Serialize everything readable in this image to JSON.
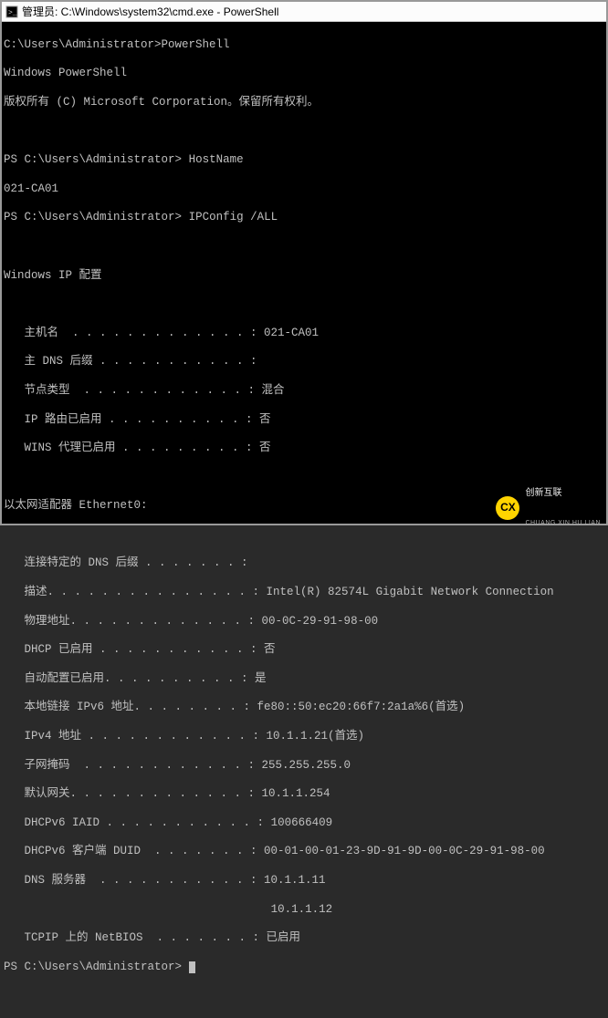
{
  "window": {
    "title": "管理员: C:\\Windows\\system32\\cmd.exe - PowerShell"
  },
  "session": {
    "prompt1_path": "C:\\Users\\Administrator>",
    "cmd1": "PowerShell",
    "banner1": "Windows PowerShell",
    "banner2": "版权所有 (C) Microsoft Corporation。保留所有权利。",
    "ps_prompt": "PS C:\\Users\\Administrator>",
    "cmd_hostname": "HostName",
    "hostname_out": "021-CA01",
    "cmd_ipconfig": "IPConfig /ALL"
  },
  "ipconfig": {
    "header": "Windows IP 配置",
    "global": {
      "hostname_label": "   主机名  . . . . . . . . . . . . . : ",
      "hostname_value": "021-CA01",
      "dns_suffix_label": "   主 DNS 后缀 . . . . . . . . . . . :",
      "node_type_label": "   节点类型  . . . . . . . . . . . . : ",
      "node_type_value": "混合",
      "ip_routing_label": "   IP 路由已启用 . . . . . . . . . . : ",
      "ip_routing_value": "否",
      "wins_proxy_label": "   WINS 代理已启用 . . . . . . . . . : ",
      "wins_proxy_value": "否"
    },
    "adapter_header": "以太网适配器 Ethernet0:",
    "adapter": {
      "conn_dns_label": "   连接特定的 DNS 后缀 . . . . . . . :",
      "desc_label": "   描述. . . . . . . . . . . . . . . : ",
      "desc_value": "Intel(R) 82574L Gigabit Network Connection",
      "phys_label": "   物理地址. . . . . . . . . . . . . : ",
      "phys_value": "00-0C-29-91-98-00",
      "dhcp_label": "   DHCP 已启用 . . . . . . . . . . . : ",
      "dhcp_value": "否",
      "autoconf_label": "   自动配置已启用. . . . . . . . . . : ",
      "autoconf_value": "是",
      "ll_ipv6_label": "   本地链接 IPv6 地址. . . . . . . . : ",
      "ll_ipv6_value": "fe80::50:ec20:66f7:2a1a%6(首选)",
      "ipv4_label": "   IPv4 地址 . . . . . . . . . . . . : ",
      "ipv4_value": "10.1.1.21(首选)",
      "mask_label": "   子网掩码  . . . . . . . . . . . . : ",
      "mask_value": "255.255.255.0",
      "gw_label": "   默认网关. . . . . . . . . . . . . : ",
      "gw_value": "10.1.1.254",
      "iaid_label": "   DHCPv6 IAID . . . . . . . . . . . : ",
      "iaid_value": "100666409",
      "duid_label": "   DHCPv6 客户端 DUID  . . . . . . . : ",
      "duid_value": "00-01-00-01-23-9D-91-9D-00-0C-29-91-98-00",
      "dns_label": "   DNS 服务器  . . . . . . . . . . . : ",
      "dns_value1": "10.1.1.11",
      "dns_value2_pad": "                                       ",
      "dns_value2": "10.1.1.12",
      "netbios_label": "   TCPIP 上的 NetBIOS  . . . . . . . : ",
      "netbios_value": "已启用"
    }
  },
  "watermark": {
    "logo_text": "CX",
    "cn": "创新互联",
    "en": "CHUANG XIN HU LIAN"
  }
}
